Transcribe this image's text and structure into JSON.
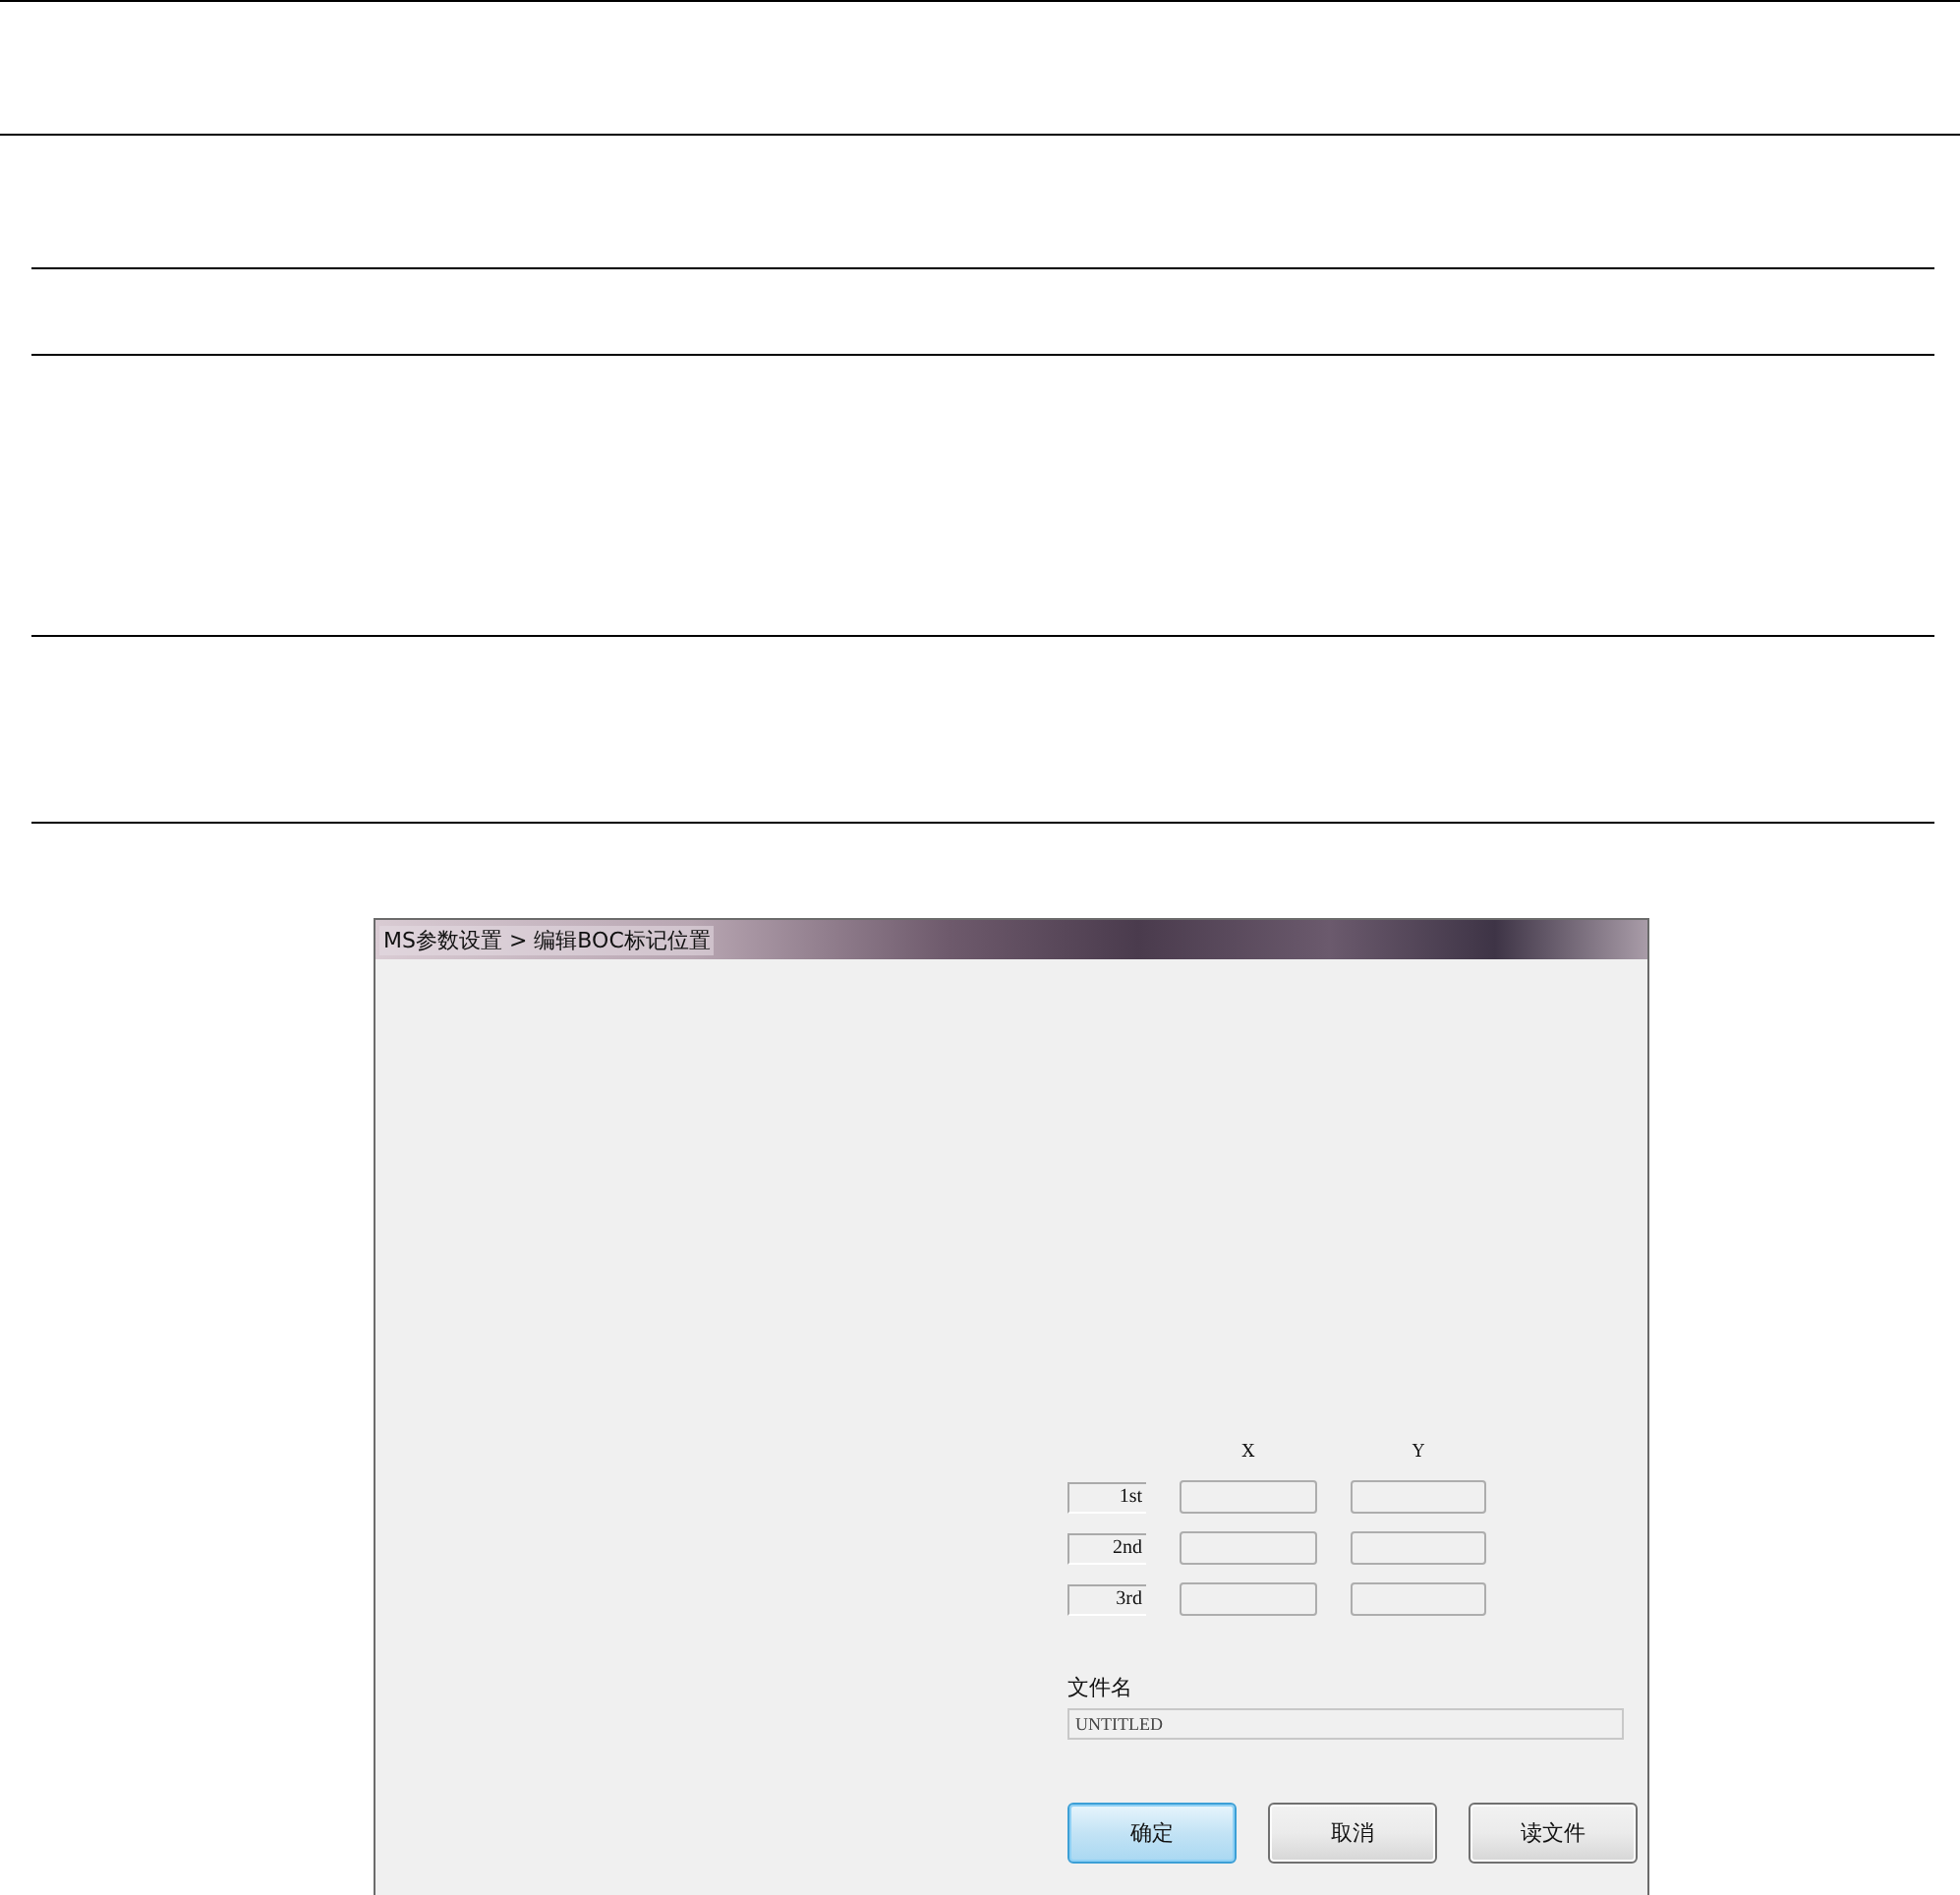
{
  "dialog": {
    "title": "MS参数设置 > 编辑BOC标记位置",
    "columns": [
      "X",
      "Y"
    ],
    "rows": [
      {
        "label": "1st"
      },
      {
        "label": "2nd"
      },
      {
        "label": "3rd"
      }
    ],
    "file_name": {
      "label": "文件名",
      "value": "UNTITLED"
    },
    "buttons": [
      {
        "label": "确定",
        "focused": true
      },
      {
        "label": "取消",
        "focused": false
      },
      {
        "label": "读文件",
        "focused": false
      }
    ]
  }
}
